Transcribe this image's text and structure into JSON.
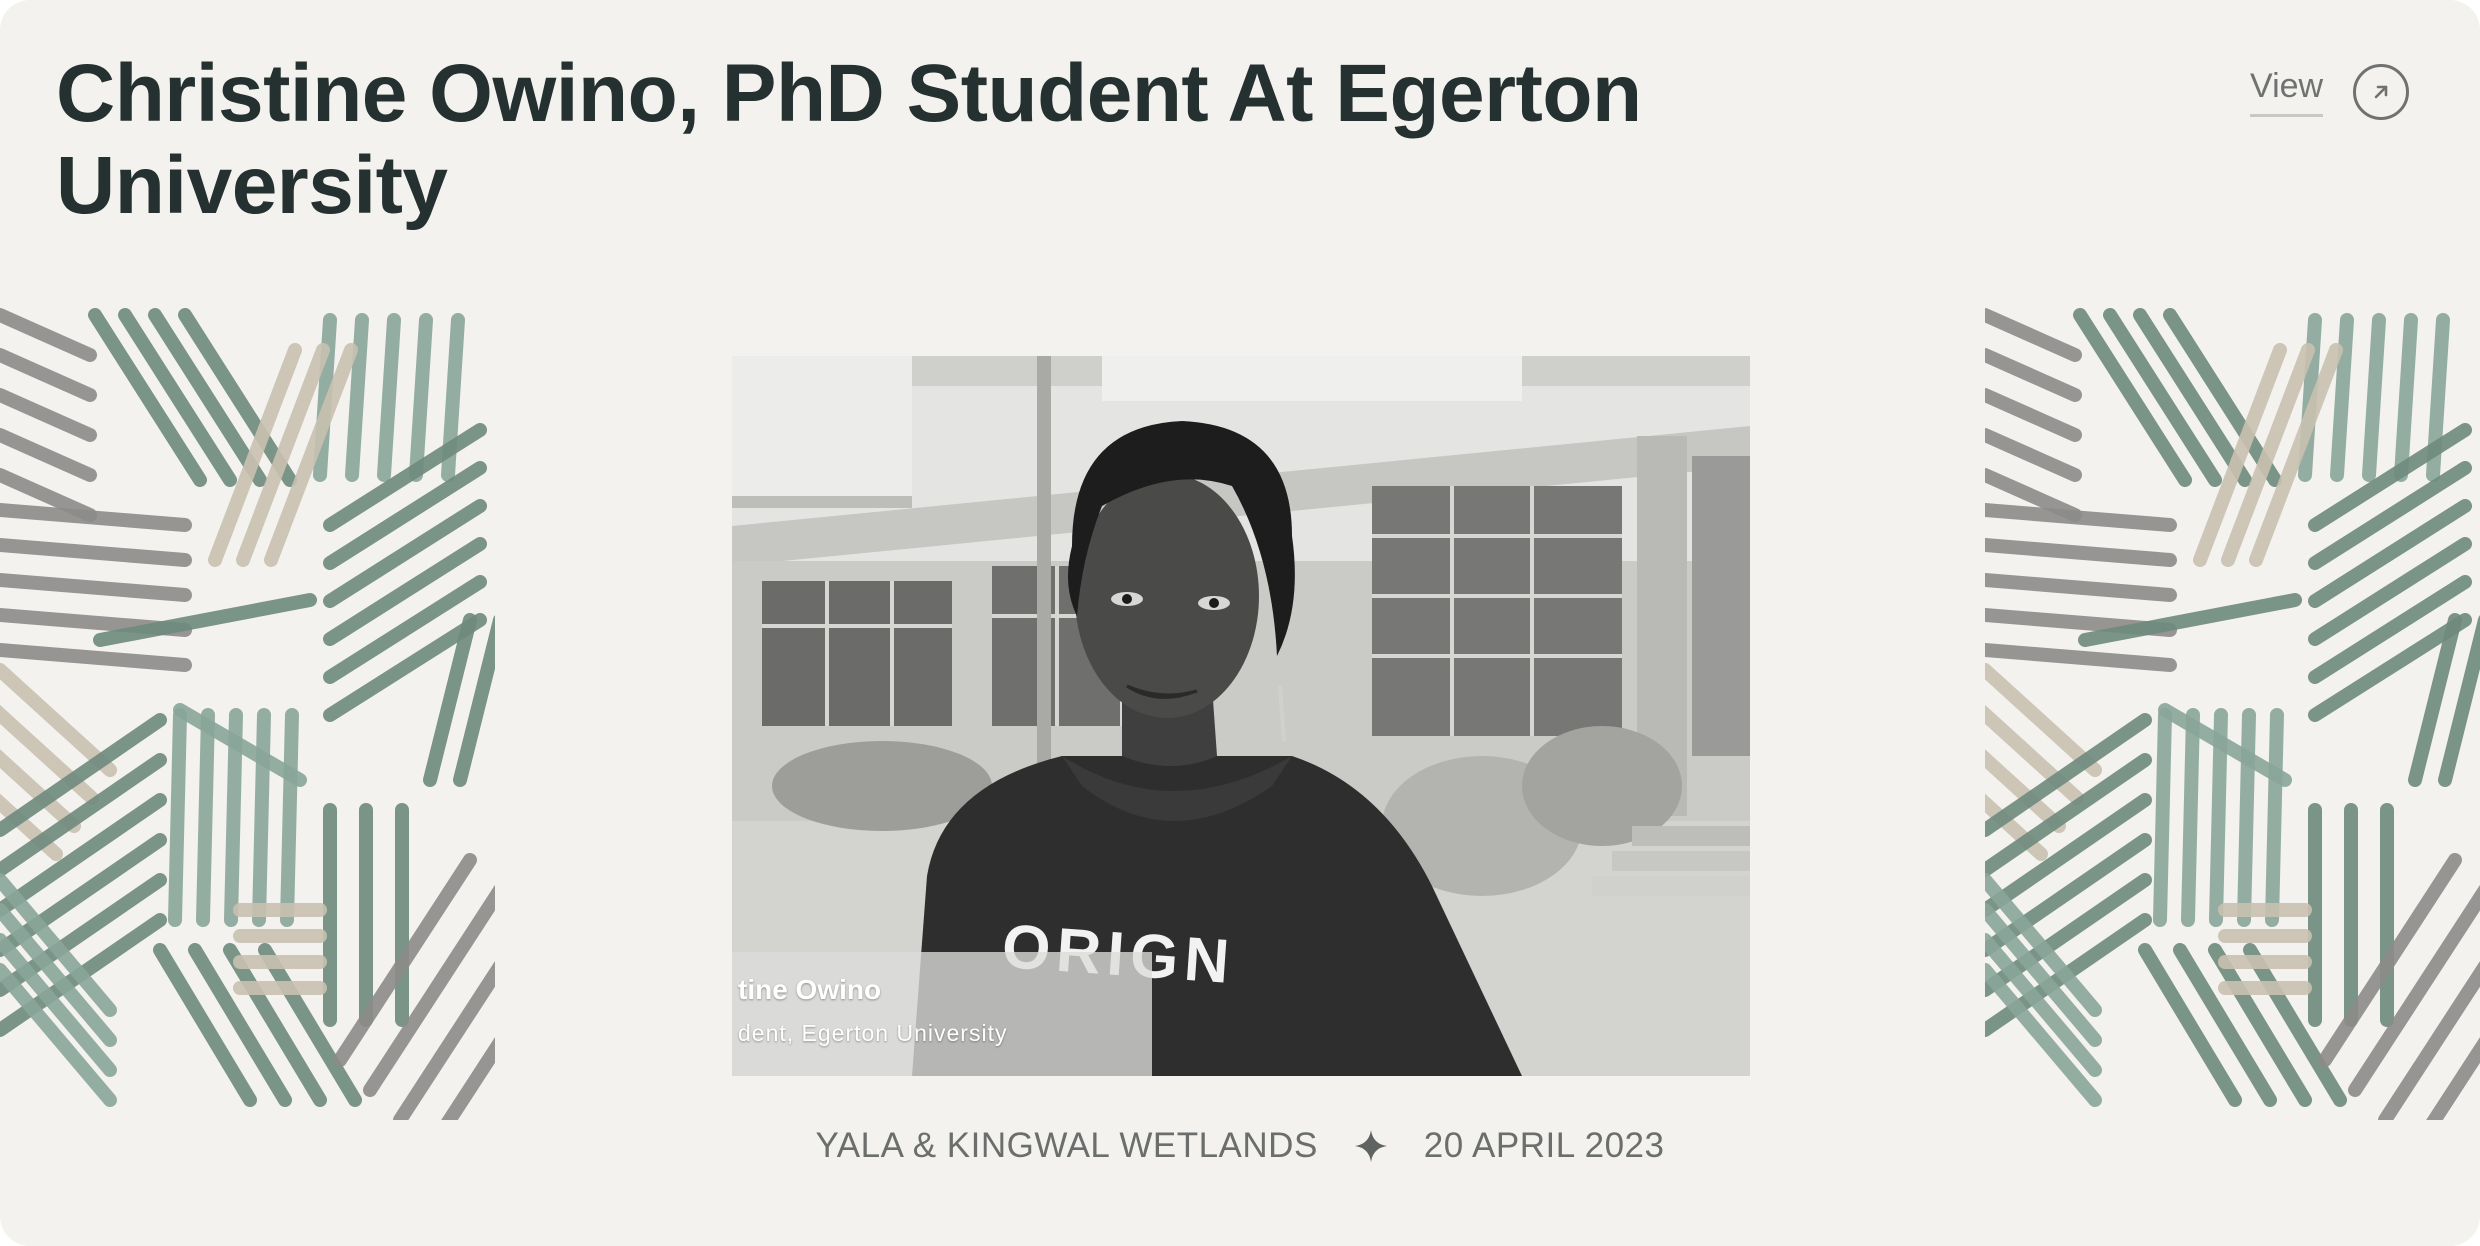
{
  "card": {
    "title": "Christine Owino, PhD Student At Egerton University",
    "view_label": "View",
    "view_icon": "arrow-up-right-icon"
  },
  "photo": {
    "caption_name": "tine Owino",
    "caption_role": "dent, Egerton University",
    "shirt_text": "ORIGN"
  },
  "meta": {
    "location": "YALA & KINGWAL WETLANDS",
    "separator_icon": "four-point-star-icon",
    "date": "20 APRIL 2023"
  },
  "colors": {
    "background": "#f3f2ee",
    "title": "#243130",
    "pattern_green": "#8aa69a",
    "pattern_dark_green": "#6f8a7e",
    "pattern_grey": "#8c8c8a",
    "pattern_beige": "#c9c1b1"
  }
}
